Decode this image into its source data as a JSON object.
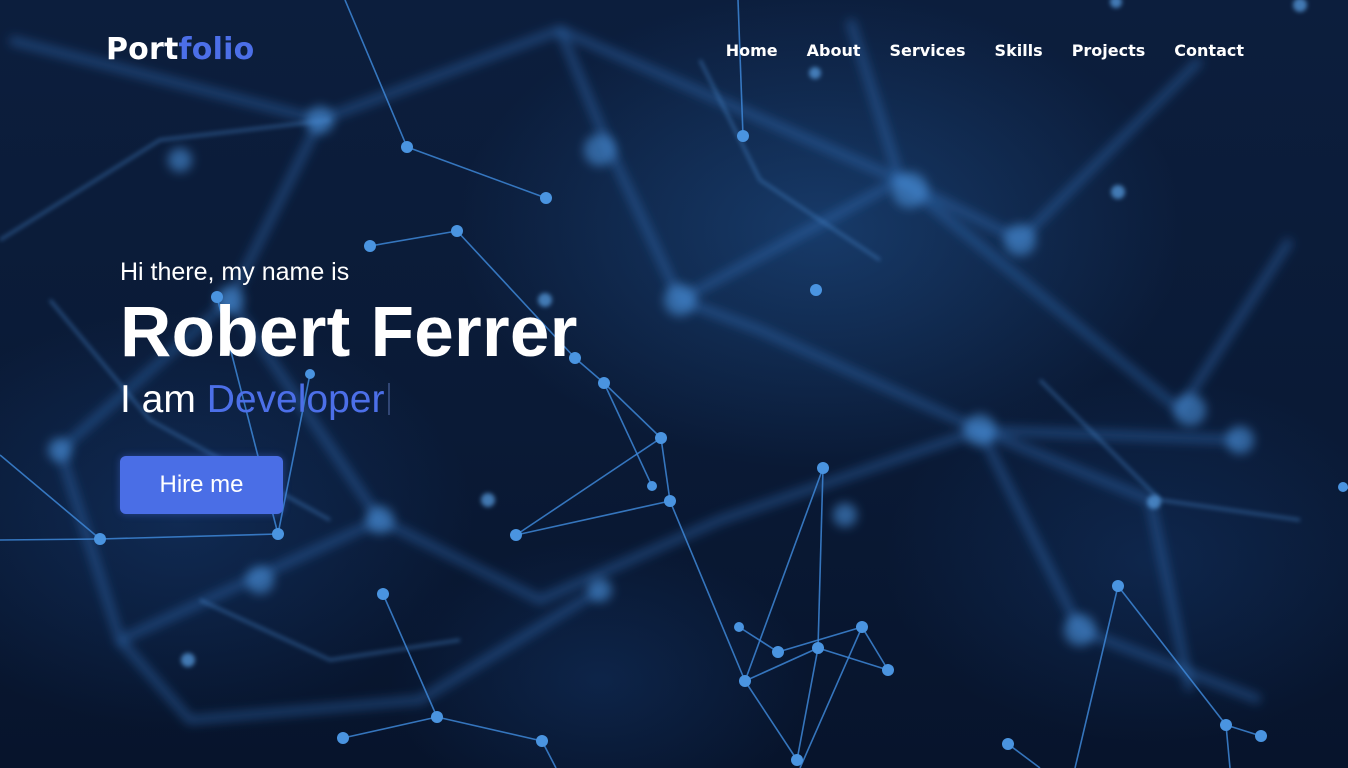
{
  "brand": {
    "logo_part1": "Port",
    "logo_part2": "folio",
    "accent_color": "#4c6fe8"
  },
  "nav": {
    "items": [
      {
        "label": "Home"
      },
      {
        "label": "About"
      },
      {
        "label": "Services"
      },
      {
        "label": "Skills"
      },
      {
        "label": "Projects"
      },
      {
        "label": "Contact"
      }
    ]
  },
  "hero": {
    "greeting": "Hi there, my name is",
    "name": "Robert Ferrer",
    "role_prefix": "I am",
    "role_typed": "Developer",
    "cta_label": "Hire me",
    "background_color": "#0a1830",
    "background_graphic": "blue-particle-network"
  }
}
